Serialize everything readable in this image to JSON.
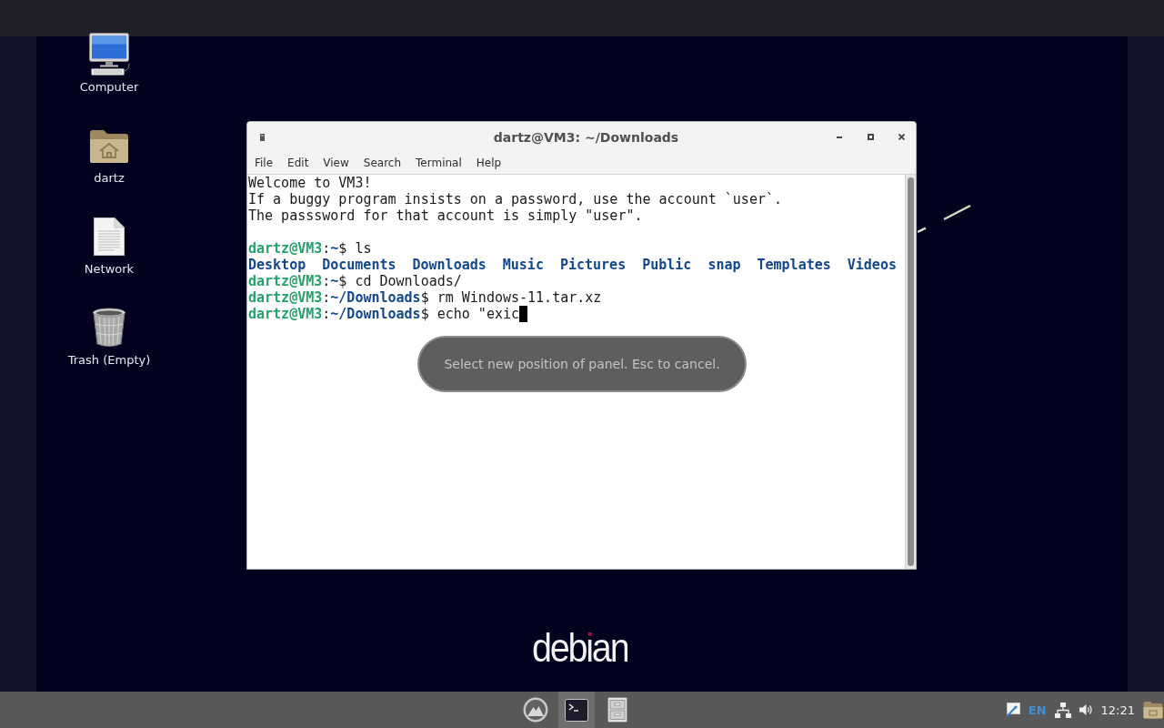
{
  "desktop_icons": [
    {
      "kind": "computer",
      "label": "Computer"
    },
    {
      "kind": "home-folder",
      "label": "dartz"
    },
    {
      "kind": "document",
      "label": "Network"
    },
    {
      "kind": "trash",
      "label": "Trash (Empty)"
    }
  ],
  "terminal_window": {
    "title": "dartz@VM3: ~/Downloads",
    "menu": [
      "File",
      "Edit",
      "View",
      "Search",
      "Terminal",
      "Help"
    ],
    "lines": [
      {
        "kind": "output",
        "text": "Welcome to VM3!",
        "cursor": false
      },
      {
        "kind": "output",
        "text": "If a buggy program insists on a password, use the account `user`.",
        "cursor": false
      },
      {
        "kind": "output",
        "text": "The passsword for that account is simply \"user\".",
        "cursor": false
      },
      {
        "kind": "blank",
        "cursor": false
      },
      {
        "kind": "prompt",
        "segments": [
          {
            "kind": "user",
            "text": "dartz@VM3"
          },
          {
            "kind": "plain",
            "text": ":"
          },
          {
            "kind": "path",
            "text": "~"
          },
          {
            "kind": "plain",
            "text": "$ ls"
          }
        ],
        "cursor": false
      },
      {
        "kind": "listing",
        "entries": [
          "Desktop",
          "Documents",
          "Downloads",
          "Music",
          "Pictures",
          "Public",
          "snap",
          "Templates",
          "Videos"
        ],
        "cursor": false
      },
      {
        "kind": "prompt",
        "segments": [
          {
            "kind": "user",
            "text": "dartz@VM3"
          },
          {
            "kind": "plain",
            "text": ":"
          },
          {
            "kind": "path",
            "text": "~"
          },
          {
            "kind": "plain",
            "text": "$ cd Downloads/"
          }
        ],
        "cursor": false
      },
      {
        "kind": "prompt",
        "segments": [
          {
            "kind": "user",
            "text": "dartz@VM3"
          },
          {
            "kind": "plain",
            "text": ":"
          },
          {
            "kind": "path",
            "text": "~/Downloads"
          },
          {
            "kind": "plain",
            "text": "$ rm Windows-11.tar.xz"
          }
        ],
        "cursor": false
      },
      {
        "kind": "prompt",
        "segments": [
          {
            "kind": "user",
            "text": "dartz@VM3"
          },
          {
            "kind": "plain",
            "text": ":"
          },
          {
            "kind": "path",
            "text": "~/Downloads"
          },
          {
            "kind": "plain",
            "text": "$ echo \"exic"
          }
        ],
        "cursor": true
      }
    ]
  },
  "panel_hint": {
    "text": "Select new position of panel. Esc to cancel."
  },
  "wallpaper": {
    "logo": "debian"
  },
  "taskbar": {
    "apps": [
      {
        "kind": "launcher",
        "selected": false
      },
      {
        "kind": "terminal",
        "selected": true
      },
      {
        "kind": "file-manager",
        "selected": false
      }
    ],
    "tray": {
      "language": "EN",
      "clock": "12:21"
    }
  }
}
